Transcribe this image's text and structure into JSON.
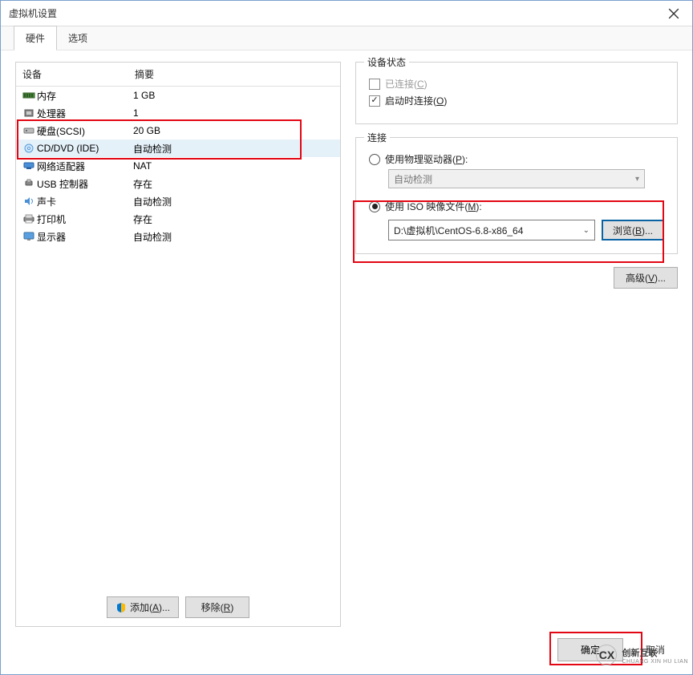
{
  "window": {
    "title": "虚拟机设置"
  },
  "tabs": {
    "hardware": "硬件",
    "options": "选项"
  },
  "device_header": {
    "device": "设备",
    "summary": "摘要"
  },
  "devices": [
    {
      "id": "memory",
      "name": "内存",
      "summary": "1 GB"
    },
    {
      "id": "cpu",
      "name": "处理器",
      "summary": "1"
    },
    {
      "id": "hdd",
      "name": "硬盘(SCSI)",
      "summary": "20 GB"
    },
    {
      "id": "cddvd",
      "name": "CD/DVD (IDE)",
      "summary": "自动检测"
    },
    {
      "id": "net",
      "name": "网络适配器",
      "summary": "NAT"
    },
    {
      "id": "usb",
      "name": "USB 控制器",
      "summary": "存在"
    },
    {
      "id": "sound",
      "name": "声卡",
      "summary": "自动检测"
    },
    {
      "id": "printer",
      "name": "打印机",
      "summary": "存在"
    },
    {
      "id": "display",
      "name": "显示器",
      "summary": "自动检测"
    }
  ],
  "buttons": {
    "add_pre": "添加(",
    "add_u": "A",
    "add_post": ")...",
    "remove_pre": "移除(",
    "remove_u": "R",
    "remove_post": ")",
    "browse_pre": "浏览(",
    "browse_u": "B",
    "browse_post": ")...",
    "advanced_pre": "高级(",
    "advanced_u": "V",
    "advanced_post": ")...",
    "ok": "确定",
    "cancel": "取消"
  },
  "status_group": {
    "legend": "设备状态",
    "connected_pre": "已连接(",
    "connected_u": "C",
    "connected_post": ")",
    "connect_on_pre": "启动时连接(",
    "connect_on_u": "O",
    "connect_on_post": ")"
  },
  "conn_group": {
    "legend": "连接",
    "physical_pre": "使用物理驱动器(",
    "physical_u": "P",
    "physical_post": "):",
    "auto_detect": "自动检测",
    "iso_pre": "使用 ISO 映像文件(",
    "iso_u": "M",
    "iso_post": "):",
    "iso_path": "D:\\虚拟机\\CentOS-6.8-x86_64"
  },
  "logo": {
    "text_top": "创新互联",
    "text_bottom": "CHUANG XIN HU LIAN",
    "mark": "CX"
  },
  "colors": {
    "highlight": "#e30613",
    "focus_blue": "#0a64a4"
  }
}
